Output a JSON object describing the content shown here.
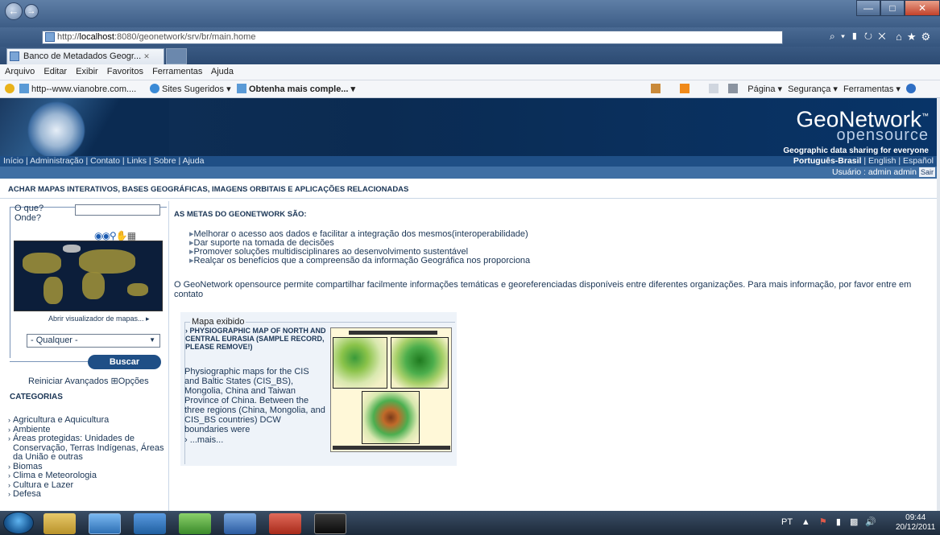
{
  "browser": {
    "url_prefix": "http://",
    "url_host": "localhost",
    "url_rest": ":8080/geonetwork/srv/br/main.home",
    "address_tools": "⌕ ▾ ▮ ↻ ✕",
    "tab_title": "Banco de Metadados Geogr...",
    "tab_close": "✕",
    "menu": [
      "Arquivo",
      "Editar",
      "Exibir",
      "Favoritos",
      "Ferramentas",
      "Ajuda"
    ],
    "favorites": [
      "http--www.vianobre.com....",
      "Sites Sugeridos ▾",
      "Obtenha mais comple... ▾"
    ],
    "commandbar": "▾  ▾  ▾  Página ▾  Segurança ▾  Ferramentas ▾  ▾",
    "commandbar_items": [
      "Página ▾",
      "Segurança ▾",
      "Ferramentas ▾"
    ]
  },
  "header": {
    "logo_main": "GeoNetwork",
    "logo_tm": "™",
    "logo_sub": "opensource",
    "slogan": "Geographic data sharing for everyone"
  },
  "nav": {
    "links": "Início | Administração | Contato | Links | Sobre | Ajuda",
    "lang_selected": "Português-Brasil",
    "lang_others": " | English | Español",
    "user": "Usuário : admin admin",
    "logout": "Sair"
  },
  "tagline": "ACHAR MAPAS INTERATIVOS, BASES GEOGRÁFICAS, IMAGENS ORBITAIS E APLICAÇÕES RELACIONADAS",
  "search": {
    "what_label": "O que?",
    "where_label": "Onde?",
    "open_viewer": "Abrir visualizador de mapas... ▸",
    "any_option": "- Qualquer -",
    "search_button": "Buscar",
    "reset": "Reiniciar",
    "advanced": "Avançados",
    "options": "⊞Opções"
  },
  "categories": {
    "title": "CATEGORIAS",
    "items": [
      "Agricultura e Aquicultura",
      "Ambiente",
      "Áreas protegidas: Unidades de Conservação, Terras Indígenas, Áreas da União e outras",
      "Biomas",
      "Clima e Meteorologia",
      "Cultura e Lazer",
      "Defesa"
    ]
  },
  "goals": {
    "title": "AS METAS DO GEONETWORK SÃO:",
    "items": [
      "Melhorar o acesso aos dados e facilitar a integração dos mesmos(interoperabilidade)",
      "Dar suporte na tomada de decisões",
      "Promover soluções multidisciplinares ao desenvolvimento sustentável",
      "Realçar os benefícios que a compreensão da informação Geográfica nos proporciona"
    ],
    "intro": "O GeoNetwork opensource permite compartilhar facilmente informações temáticas e georeferenciadas disponíveis entre diferentes organizações. Para mais informação, por favor entre em contato"
  },
  "featured_map": {
    "legend": "Mapa exibido",
    "title": "PHYSIOGRAPHIC MAP OF NORTH AND CENTRAL EURASIA (SAMPLE RECORD, PLEASE REMOVE!)",
    "description": "Physiographic maps for the CIS and Baltic States (CIS_BS), Mongolia, China and Taiwan Province of China. Between the three regions (China, Mongolia, and CIS_BS countries) DCW boundaries were",
    "more": "...mais..."
  },
  "taskbar": {
    "lang": "PT",
    "time": "09:44",
    "date": "20/12/2011"
  }
}
